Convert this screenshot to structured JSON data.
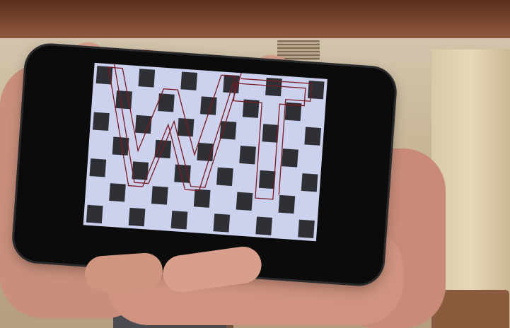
{
  "scene": {
    "description_name": "hand-holding-phone-checkerboard",
    "board_text": "WT"
  },
  "colors": {
    "board_light": "#ccd1ee",
    "board_dark": "#2f3036",
    "wireframe": "#7b1a22"
  }
}
